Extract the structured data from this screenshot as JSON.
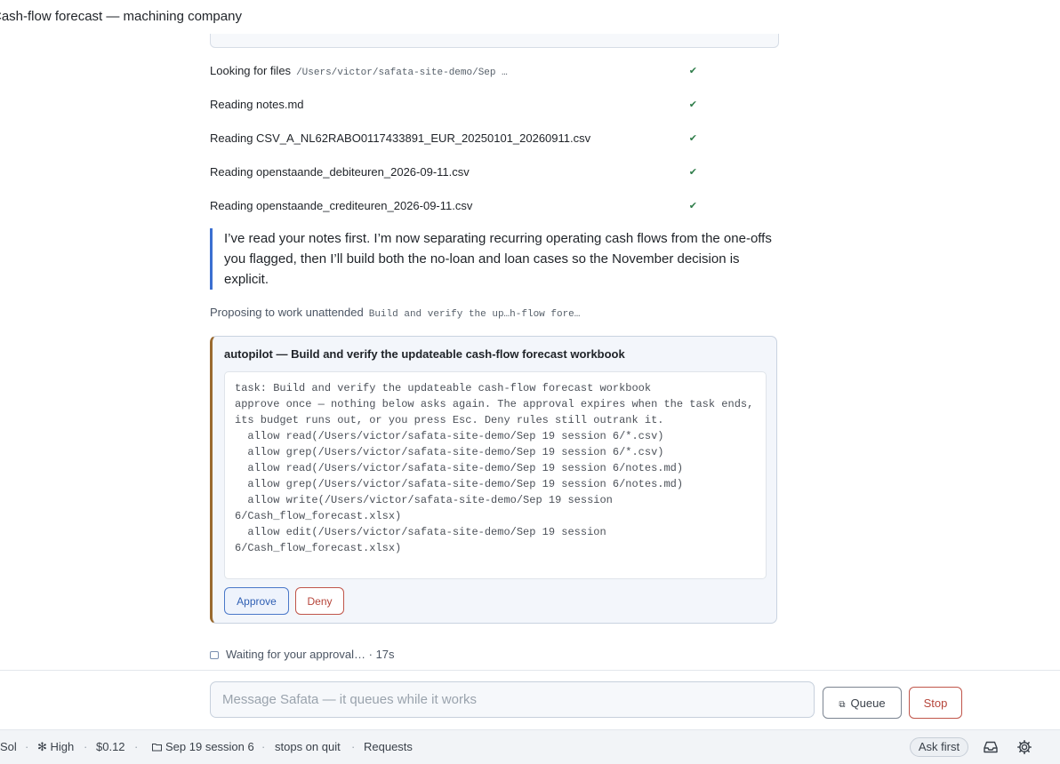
{
  "window": {
    "title": "Cash-flow forecast — machining company"
  },
  "steps": [
    {
      "label": "Looking for files",
      "path": "/Users/victor/safata-site-demo/Sep …",
      "status": "✔"
    },
    {
      "label": "Reading notes.md",
      "status": "✔"
    },
    {
      "label": "Reading CSV_A_NL62RABO0117433891_EUR_20250101_20260911.csv",
      "status": "✔"
    },
    {
      "label": "Reading openstaande_debiteuren_2026-09-11.csv",
      "status": "✔"
    },
    {
      "label": "Reading openstaande_crediteuren_2026-09-11.csv",
      "status": "✔"
    }
  ],
  "assistant_message": "I’ve read your notes first. I’m now separating recurring operating cash flows from the one-offs you flagged, then I’ll build both the no-loan and loan cases so the November decision is explicit.",
  "proposal": {
    "label": "Proposing to work unattended",
    "summary": "Build and verify the up…h-flow fore…"
  },
  "autopilot": {
    "title": "autopilot — Build and verify the updateable cash-flow forecast workbook",
    "body": "task: Build and verify the updateable cash-flow forecast workbook\napprove once — nothing below asks again. The approval expires when the task ends,\nits budget runs out, or you press Esc. Deny rules still outrank it.\n  allow read(/Users/victor/safata-site-demo/Sep 19 session 6/*.csv)\n  allow grep(/Users/victor/safata-site-demo/Sep 19 session 6/*.csv)\n  allow read(/Users/victor/safata-site-demo/Sep 19 session 6/notes.md)\n  allow grep(/Users/victor/safata-site-demo/Sep 19 session 6/notes.md)\n  allow write(/Users/victor/safata-site-demo/Sep 19 session 6/Cash_flow_forecast.xlsx)\n  allow edit(/Users/victor/safata-site-demo/Sep 19 session 6/Cash_flow_forecast.xlsx)",
    "approve_label": "Approve",
    "deny_label": "Deny"
  },
  "waiting": "Waiting for your approval… · 17s",
  "composer": {
    "placeholder": "Message Safata — it queues while it works",
    "queue_label": "Queue",
    "stop_label": "Stop"
  },
  "statusbar": {
    "model": "Sol",
    "effort": "✻ High",
    "cost": "$0.12",
    "folder": "Sep 19 session 6",
    "lifecycle": "stops on quit",
    "requests": "Requests",
    "permission_mode": "Ask first",
    "separator": "·"
  },
  "icons": {
    "folder": "folder-icon",
    "inbox": "inbox-icon",
    "settings": "gear-icon",
    "waiting": "lock-icon",
    "queue": "queue-icon",
    "check": "check-icon"
  }
}
